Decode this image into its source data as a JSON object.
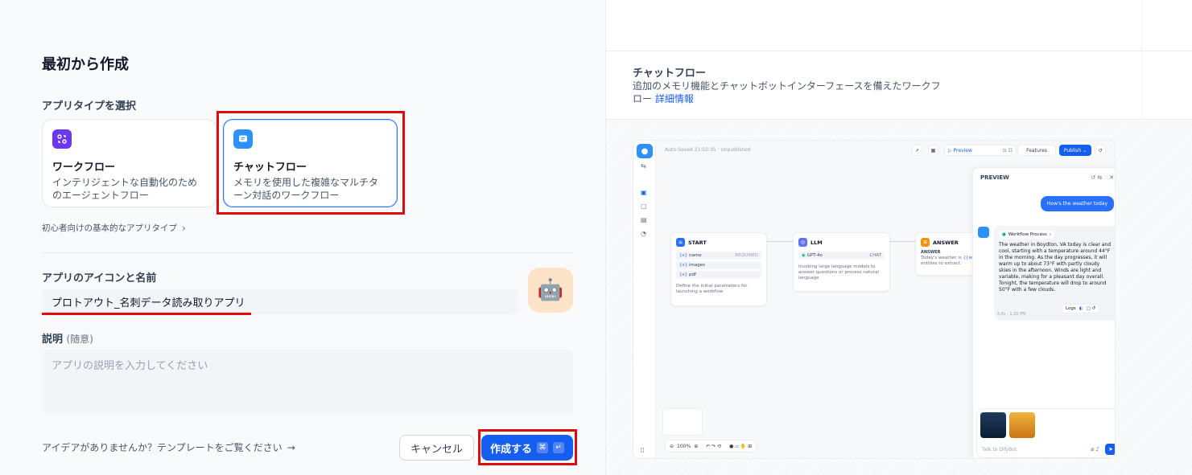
{
  "form": {
    "title": "最初から作成",
    "app_type_label": "アプリタイプを選択",
    "types": [
      {
        "name": "ワークフロー",
        "desc": "インテリジェントな自動化のためのエージェントフロー",
        "icon": "workflow-icon",
        "color": "#6938ef"
      },
      {
        "name": "チャットフロー",
        "desc": "メモリを使用した複雑なマルチターン対話のワークフロー",
        "icon": "chatflow-icon",
        "color": "#2e90fa"
      }
    ],
    "beginner_link": "初心者向けの基本的なアプリタイプ",
    "icon_name_label": "アプリのアイコンと名前",
    "name_value": "プロトアウト_名刺データ読み取りアプリ",
    "avatar_emoji": "🤖",
    "description_label": "説明",
    "description_optional": "(随意)",
    "description_placeholder": "アプリの説明を入力してください",
    "idea_text": "アイデアがありませんか？テンプレートをご覧ください",
    "cancel_label": "キャンセル",
    "create_label": "作成する",
    "create_kbd1": "⌘",
    "create_kbd2": "↵",
    "accent_color": "#155eef",
    "highlight_color": "#e00b0b"
  },
  "detail": {
    "title": "チャットフロー",
    "desc": "追加のメモリ機能とチャットボットインターフェースを備えたワークフロー",
    "link": "詳細情報"
  },
  "preview": {
    "autosaved": "Auto-Saved 21:02:35 · Unpublished",
    "preview_btn": "▷ Preview",
    "features_btn": "Features",
    "publish_btn": "Publish ⌄",
    "badge": "2",
    "nodes": {
      "start": {
        "title": "START",
        "vars": [
          "name",
          "images",
          "pdf"
        ],
        "required": "REQUIRED",
        "desc": "Define the initial parameters for launching a workflow"
      },
      "llm": {
        "title": "LLM",
        "model": "GPT-4o",
        "mode": "CHAT",
        "desc": "Invoking large language models to answer questions or process natural language"
      },
      "answer": {
        "title": "ANSWER",
        "label": "ANSWER",
        "desc_prefix": "Today's weather is",
        "desc_mid": "{{w",
        "desc_end": "entities to extract."
      }
    },
    "chat": {
      "title": "PREVIEW",
      "user_msg": "How's the weather today",
      "workflow_process": "Workflow Process",
      "bot_msg": "The weather in Boydton, VA today is clear and cool, starting with a temperature around 44°F in the morning. As the day progresses, it will warm up to about 73°F with partly cloudy skies in the afternoon. Winds are light and variable, making for a pleasant day overall. Tonight, the temperature will drop to around 50°F with a few clouds.",
      "meta": "5.6s · 1:20 PM",
      "logs": "Logs",
      "placeholder": "Talk to DifyBot"
    },
    "zoom": "100%"
  }
}
